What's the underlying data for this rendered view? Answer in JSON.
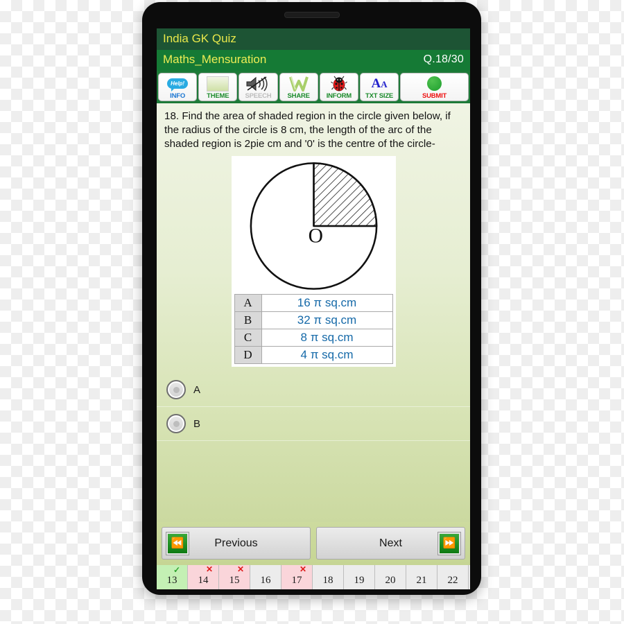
{
  "app": {
    "title": "India GK Quiz",
    "quiz_name": "Maths_Mensuration",
    "question_counter": "Q.18/30"
  },
  "toolbar": {
    "items": [
      {
        "icon": "help-icon",
        "label": "INFO"
      },
      {
        "icon": "theme-icon",
        "label": "THEME"
      },
      {
        "icon": "speaker-mute-icon",
        "label": "SPEECH"
      },
      {
        "icon": "share-icon",
        "label": "SHARE"
      },
      {
        "icon": "ladybug-icon",
        "label": "INFORM"
      },
      {
        "icon": "text-size-icon",
        "label": "TXT SIZE"
      },
      {
        "icon": "green-circle-icon",
        "label": "SUBMIT"
      }
    ],
    "help_text": "Help!"
  },
  "question": {
    "text": "18.  Find the area of shaded region in the circle given below, if the radius of the circle is 8 cm, the length of the arc of the shaded region is 2pie cm and '0' is the centre of the circle-",
    "figure": {
      "center_label": "O",
      "shaded_quadrant": "upper-right",
      "description": "circle-with-shaded-quadrant"
    },
    "options_table": [
      {
        "key": "A",
        "value": "16 π sq.cm"
      },
      {
        "key": "B",
        "value": "32 π sq.cm"
      },
      {
        "key": "C",
        "value": "8 π sq.cm"
      },
      {
        "key": "D",
        "value": "4 π sq.cm"
      }
    ]
  },
  "choices": [
    {
      "label": "A",
      "selected": false
    },
    {
      "label": "B",
      "selected": false
    }
  ],
  "nav": {
    "previous_label": "Previous",
    "next_label": "Next",
    "previous_icon": "skip-previous-icon",
    "next_icon": "skip-next-icon"
  },
  "question_strip": [
    {
      "number": "13",
      "state": "correct",
      "mark": "✓"
    },
    {
      "number": "14",
      "state": "wrong",
      "mark": "✕"
    },
    {
      "number": "15",
      "state": "wrong",
      "mark": "✕"
    },
    {
      "number": "16",
      "state": "neutral",
      "mark": ""
    },
    {
      "number": "17",
      "state": "wrong",
      "mark": "✕"
    },
    {
      "number": "18",
      "state": "neutral",
      "mark": ""
    },
    {
      "number": "19",
      "state": "neutral",
      "mark": ""
    },
    {
      "number": "20",
      "state": "neutral",
      "mark": ""
    },
    {
      "number": "21",
      "state": "neutral",
      "mark": ""
    },
    {
      "number": "22",
      "state": "neutral",
      "mark": ""
    }
  ],
  "colors": {
    "appbar": "#1d5434",
    "quizbar": "#157a35",
    "toolbar_bg": "#1d7a38",
    "accent_yellow": "#e8e74a",
    "option_text": "#1569a8",
    "submit_red": "#ee1111",
    "correct_green": "#c4f0b4",
    "wrong_pink": "#fad5da"
  }
}
